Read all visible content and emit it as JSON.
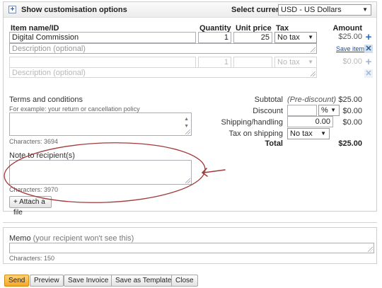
{
  "header": {
    "customise_label": "Show customisation options",
    "currency_label": "Select currency",
    "currency_value": "USD - US Dollars"
  },
  "columns": {
    "item": "Item name/ID",
    "quantity": "Quantity",
    "unit_price": "Unit price",
    "tax": "Tax",
    "amount": "Amount"
  },
  "items": [
    {
      "name": "Digital Commission",
      "quantity": "1",
      "unit_price": "25",
      "tax": "No tax",
      "amount": "$25.00",
      "description_placeholder": "Description (optional)",
      "save_item": "Save item"
    },
    {
      "name": "",
      "quantity": "1",
      "unit_price": "",
      "tax": "No tax",
      "amount": "$0.00",
      "description_placeholder": "Description (optional)"
    }
  ],
  "terms": {
    "label": "Terms and conditions",
    "hint": "For example: your return or cancellation policy",
    "chars": "Characters: 3694"
  },
  "totals": {
    "subtotal_label": "Subtotal",
    "subtotal_note": "(Pre-discount)",
    "subtotal_value": "$25.00",
    "discount_label": "Discount",
    "discount_unit": "%",
    "discount_value": "$0.00",
    "shipping_label": "Shipping/handling",
    "shipping_input": "0.00",
    "shipping_value": "$0.00",
    "tax_shipping_label": "Tax on shipping",
    "tax_shipping_select": "No tax",
    "total_label": "Total",
    "total_value": "$25.00"
  },
  "note": {
    "label": "Note to recipient(s)",
    "chars": "Characters: 3970"
  },
  "attach_label": "+ Attach a file",
  "memo": {
    "label": "Memo",
    "hint": "(your recipient won't see this)",
    "chars": "Characters: 150"
  },
  "actions": {
    "send": "Send",
    "preview": "Preview",
    "save_invoice": "Save Invoice",
    "save_template": "Save as Template",
    "close": "Close"
  },
  "colors": {
    "annotation": "#a23a3a",
    "accent": "#2a6ec2"
  }
}
